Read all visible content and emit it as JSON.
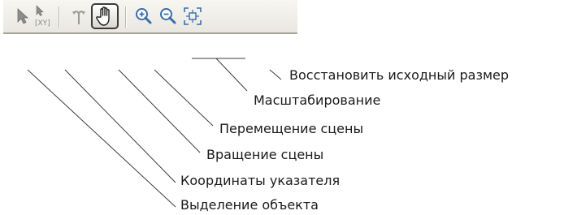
{
  "toolbar": {
    "tools": [
      {
        "icon": "select-arrow-icon",
        "active": false
      },
      {
        "icon": "pointer-coordinates-icon",
        "active": false,
        "caption": "[XY]"
      },
      {
        "icon": "rotate-scene-icon",
        "active": false
      },
      {
        "icon": "hand-pan-icon",
        "active": true
      },
      {
        "icon": "zoom-in-icon",
        "active": false
      },
      {
        "icon": "zoom-out-icon",
        "active": false
      },
      {
        "icon": "fit-to-size-icon",
        "active": false
      }
    ]
  },
  "callouts": {
    "reset_size": "Восстановить исходный размер",
    "zoom": "Масштабирование",
    "move_scene": "Перемещение сцены",
    "rotate_scene": "Вращение сцены",
    "pointer_coordinates": "Координаты указателя",
    "select_object": "Выделение объекта"
  },
  "colors": {
    "icon_gray": "#8c8c8c",
    "icon_blue": "#3a6ea8",
    "leader_line": "#3c3c3c"
  }
}
